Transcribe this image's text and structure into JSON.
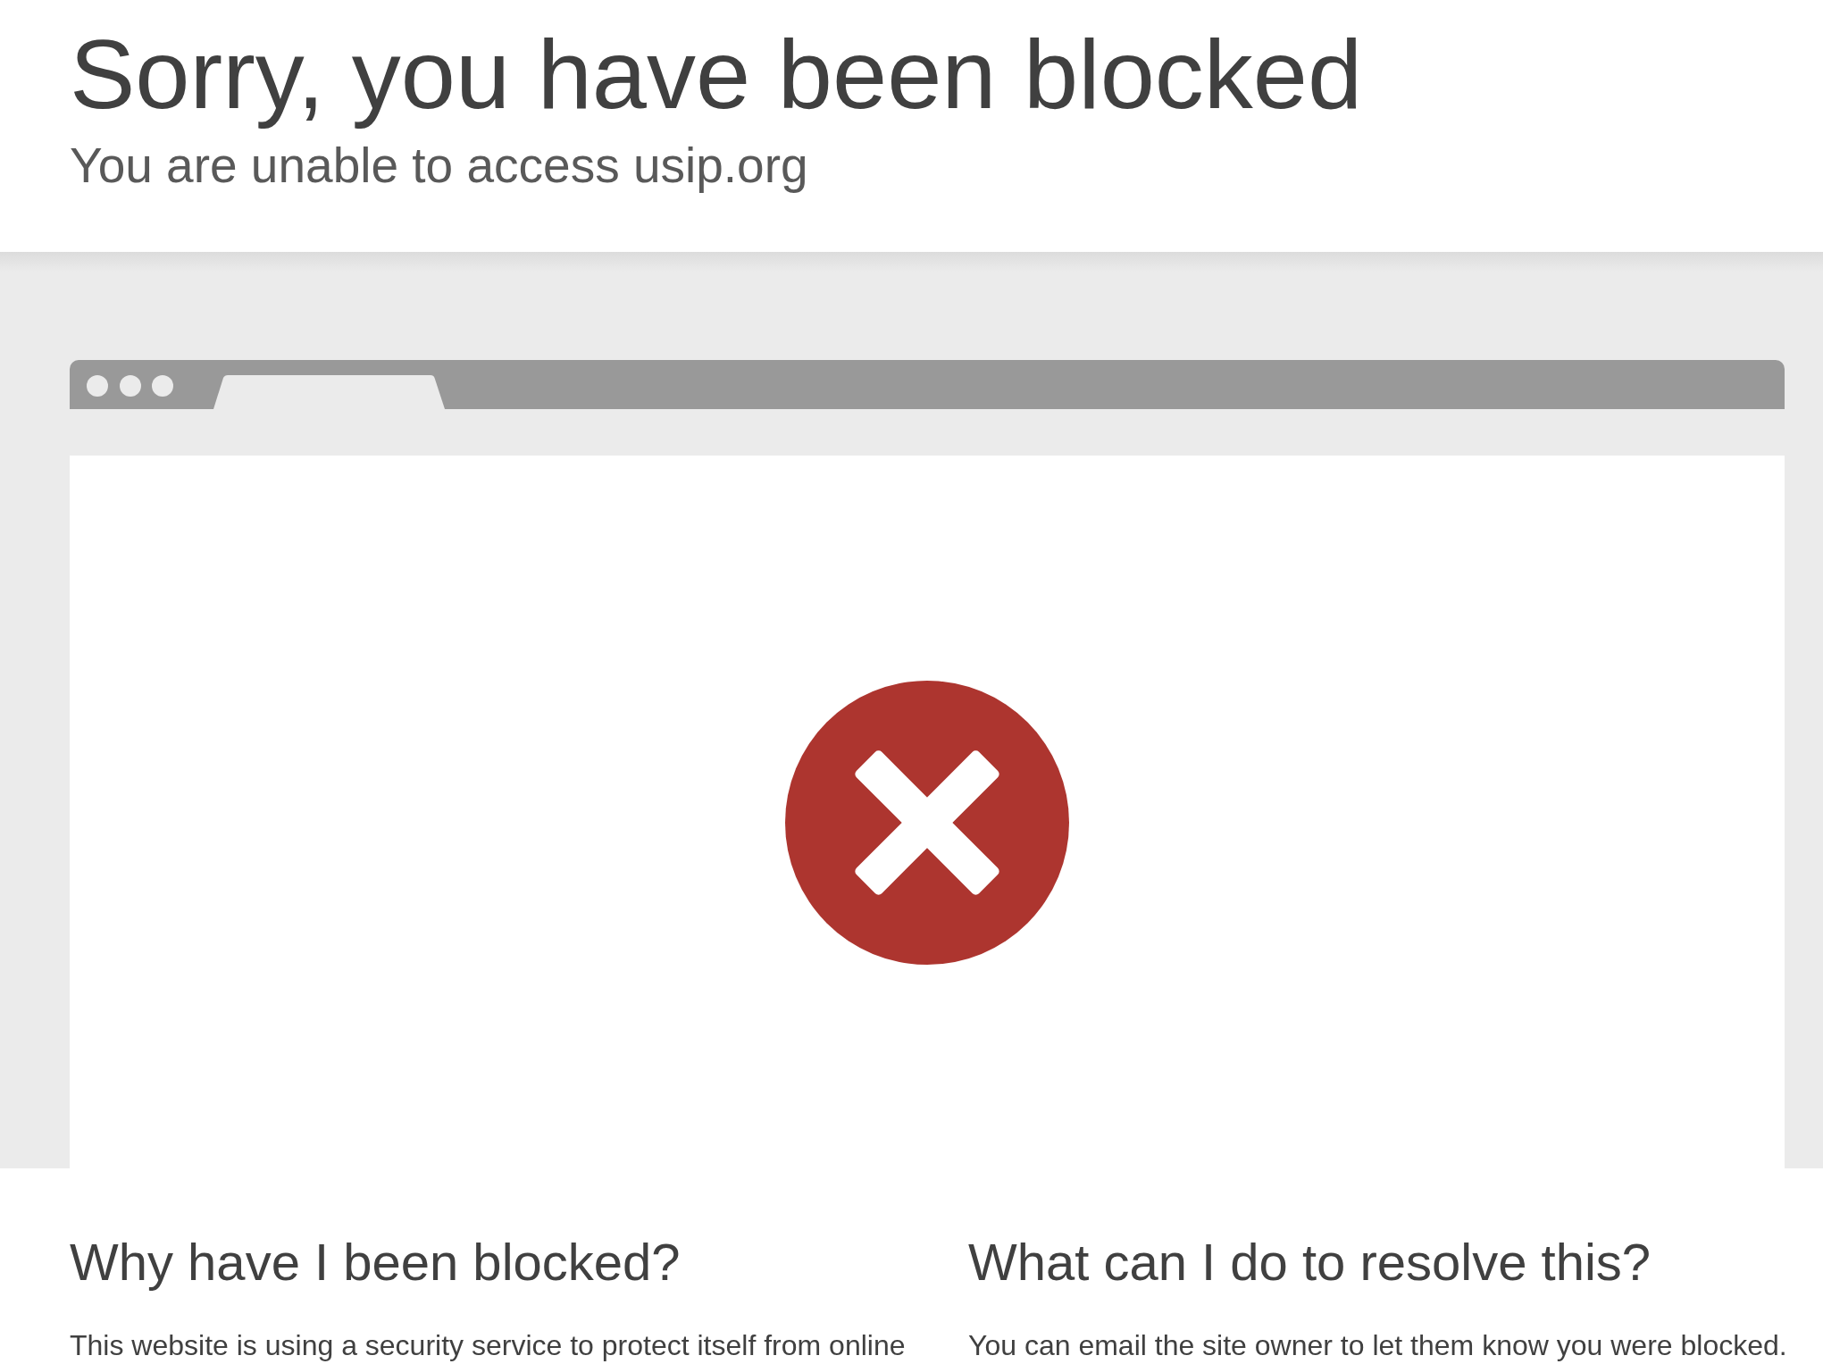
{
  "header": {
    "title": "Sorry, you have been blocked",
    "subtitle": "You are unable to access usip.org"
  },
  "sections": [
    {
      "heading": "Why have I been blocked?",
      "text": "This website is using a security service to protect itself from online"
    },
    {
      "heading": "What can I do to resolve this?",
      "text": "You can email the site owner to let them know you were blocked."
    }
  ]
}
